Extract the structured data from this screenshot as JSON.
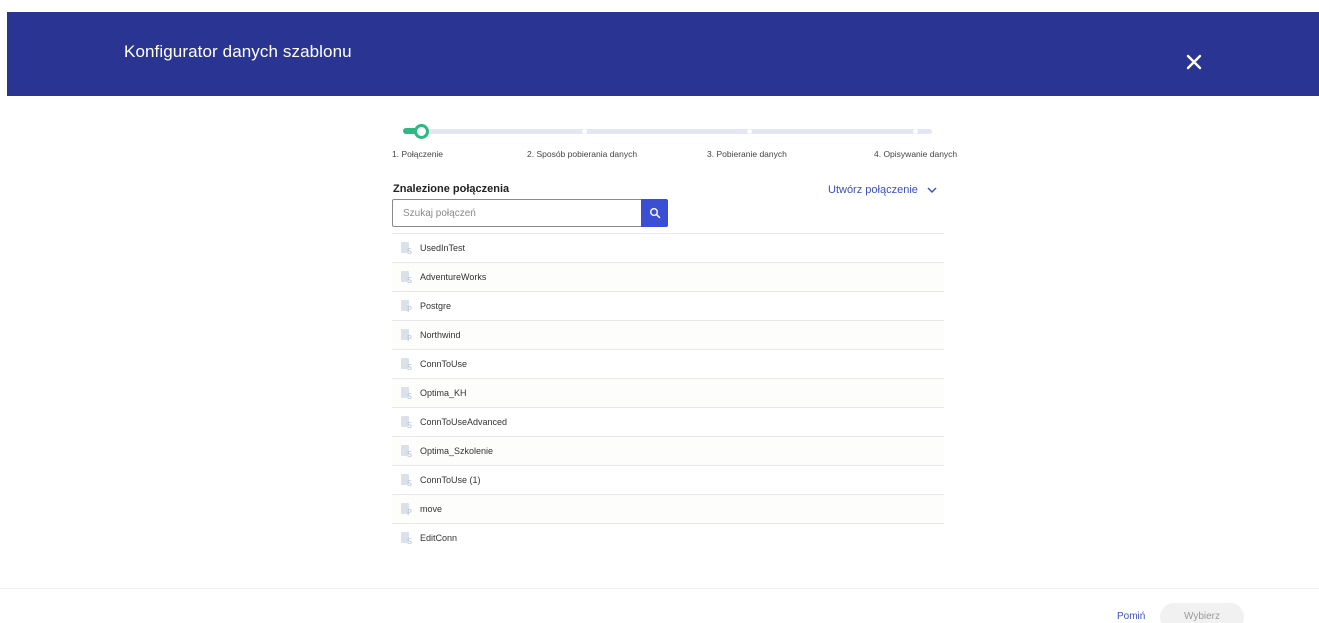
{
  "header": {
    "title": "Konfigurator danych szablonu",
    "close_icon": "close-icon",
    "background": "#2a3593"
  },
  "stepper": {
    "current_step": 1,
    "accent": "#2fb784",
    "steps": [
      {
        "label": "1. Połączenie"
      },
      {
        "label": "2. Sposób pobierania danych"
      },
      {
        "label": "3. Pobieranie danych"
      },
      {
        "label": "4. Opisywanie danych"
      }
    ]
  },
  "connections": {
    "title": "Znalezione połączenia",
    "create_label": "Utwórz połączenie",
    "search_placeholder": "Szukaj połączeń",
    "search_value": "",
    "items": [
      {
        "label": "UsedInTest",
        "icon": "database-s-icon"
      },
      {
        "label": "AdventureWorks",
        "icon": "database-s-icon"
      },
      {
        "label": "Postgre",
        "icon": "database-p-icon"
      },
      {
        "label": "Northwind",
        "icon": "database-p-icon"
      },
      {
        "label": "ConnToUse",
        "icon": "database-s-icon"
      },
      {
        "label": "Optima_KH",
        "icon": "database-s-icon"
      },
      {
        "label": "ConnToUseAdvanced",
        "icon": "database-s-icon"
      },
      {
        "label": "Optima_Szkolenie",
        "icon": "database-s-icon"
      },
      {
        "label": "ConnToUse (1)",
        "icon": "database-s-icon"
      },
      {
        "label": "move",
        "icon": "database-p-icon"
      },
      {
        "label": "EditConn",
        "icon": "database-s-icon"
      }
    ]
  },
  "footer": {
    "skip_label": "Pomiń",
    "choose_label": "Wybierz"
  }
}
